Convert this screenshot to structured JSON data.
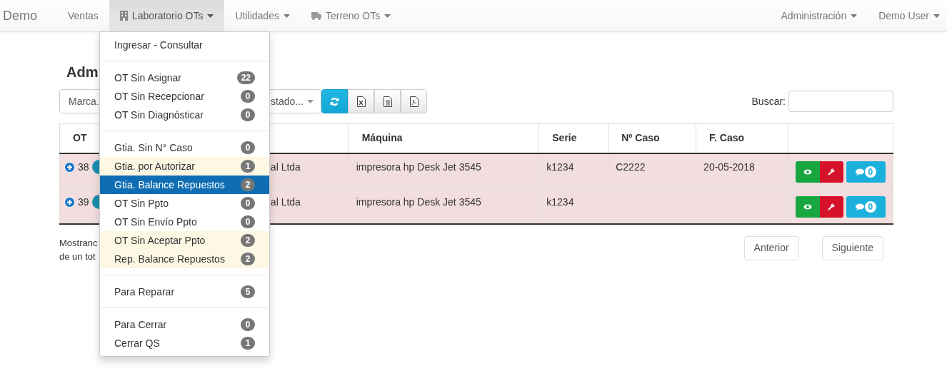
{
  "navbar": {
    "brand": "Demo",
    "left_items": [
      {
        "label": "Ventas",
        "dropdown": false,
        "selected": false
      },
      {
        "label": "Laboratorio OTs",
        "dropdown": true,
        "selected": true
      },
      {
        "label": "Utilidades",
        "dropdown": true,
        "selected": false
      },
      {
        "label": "Terreno OTs",
        "dropdown": true,
        "selected": false
      }
    ],
    "right_items": [
      {
        "label": "Administración",
        "dropdown": true
      },
      {
        "label": "Demo User",
        "dropdown": true
      }
    ]
  },
  "dropdown_menu": {
    "groups": [
      [
        {
          "label": "Ingresar - Consultar",
          "highlight": false,
          "selected": false
        }
      ],
      [
        {
          "label": "OT Sin Asignar",
          "count": "22",
          "highlight": false,
          "selected": false
        },
        {
          "label": "OT Sin Recepcionar",
          "count": "0",
          "highlight": false,
          "selected": false
        },
        {
          "label": "OT Sin Diagnósticar",
          "count": "0",
          "highlight": false,
          "selected": false
        }
      ],
      [
        {
          "label": "Gtia. Sin N° Caso",
          "count": "0",
          "highlight": false,
          "selected": false
        },
        {
          "label": "Gtia. por Autorizar",
          "count": "1",
          "highlight": true,
          "selected": false
        },
        {
          "label": "Gtia. Balance Repuestos",
          "count": "2",
          "highlight": false,
          "selected": true
        },
        {
          "label": "OT Sin Ppto",
          "count": "0",
          "highlight": false,
          "selected": false
        },
        {
          "label": "OT Sin Envío Ppto",
          "count": "0",
          "highlight": false,
          "selected": false
        },
        {
          "label": "OT Sin Aceptar Ppto",
          "count": "2",
          "highlight": true,
          "selected": false
        },
        {
          "label": "Rep. Balance Repuestos",
          "count": "2",
          "highlight": true,
          "selected": false
        }
      ],
      [
        {
          "label": "Para Reparar",
          "count": "5",
          "highlight": false,
          "selected": false
        }
      ],
      [
        {
          "label": "Para Cerrar",
          "count": "0",
          "highlight": false,
          "selected": false
        },
        {
          "label": "Cerrar QS",
          "count": "1",
          "highlight": false,
          "selected": false
        }
      ]
    ]
  },
  "page": {
    "heading": "Adm",
    "filters": [
      {
        "label": "Marca."
      },
      {
        "label": "stado...",
        "caret": true
      }
    ],
    "toolbar": [
      {
        "kind": "refresh"
      },
      {
        "kind": "excel"
      },
      {
        "kind": "document"
      },
      {
        "kind": "pdf"
      }
    ],
    "search_label": "Buscar:",
    "table": {
      "columns": [
        "OT",
        "Máquina",
        "Serie",
        "Nº Caso",
        "F. Caso"
      ],
      "rows": [
        {
          "ot": "38",
          "client": "al Ltda",
          "machine": "impresora hp Desk Jet 3545",
          "serie": "k1234",
          "case_no": "C2222",
          "case_date": "20-05-2018",
          "comments": "0",
          "highlight": true
        },
        {
          "ot": "39",
          "client": "al Ltda",
          "machine": "impresora hp Desk Jet 3545",
          "serie": "k1234",
          "comments": "0",
          "highlight": true
        }
      ]
    },
    "info_lines": [
      "Mostranc",
      "de un tot"
    ],
    "pagination": [
      "Anterior",
      "Siguiente"
    ]
  }
}
